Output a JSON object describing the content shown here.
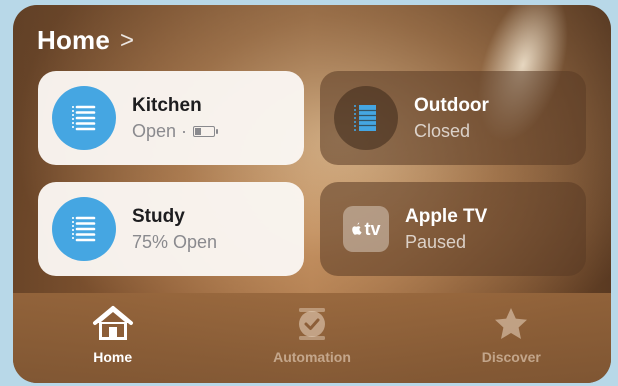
{
  "header": {
    "title": "Home",
    "chevron": ">"
  },
  "accessories": [
    {
      "name": "Kitchen",
      "status": "Open ·",
      "icon": "blinds-icon",
      "battery": true
    },
    {
      "name": "Outdoor",
      "status": "Closed",
      "icon": "blinds-icon"
    },
    {
      "name": "Study",
      "status": "75% Open",
      "icon": "blinds-icon"
    },
    {
      "name": "Apple TV",
      "status": "Paused",
      "icon": "apple-tv-icon",
      "icon_text": "tv"
    }
  ],
  "tabbar": {
    "tabs": [
      {
        "label": "Home",
        "icon": "home-icon",
        "active": true
      },
      {
        "label": "Automation",
        "icon": "automation-clock-icon",
        "active": false
      },
      {
        "label": "Discover",
        "icon": "star-icon",
        "active": false
      }
    ]
  },
  "colors": {
    "accent_blue": "#45a6e2",
    "tile_light": "#faf6f2"
  }
}
